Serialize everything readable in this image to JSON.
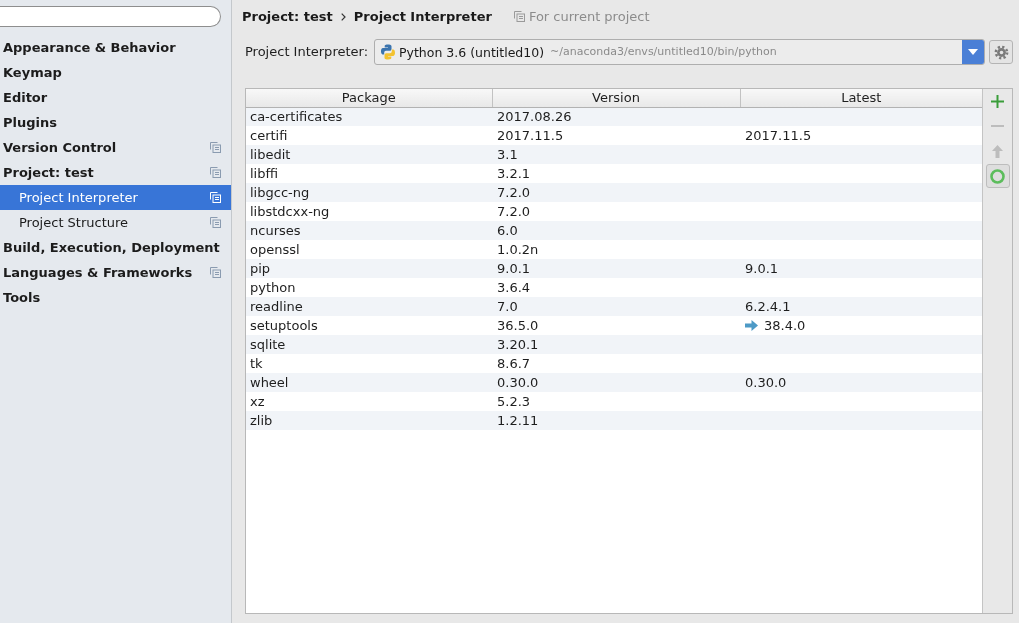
{
  "sidebar": {
    "items": [
      {
        "label": "Appearance & Behavior",
        "selected": false,
        "project_level": false
      },
      {
        "label": "Keymap",
        "selected": false,
        "project_level": false
      },
      {
        "label": "Editor",
        "selected": false,
        "project_level": false
      },
      {
        "label": "Plugins",
        "selected": false,
        "project_level": false
      },
      {
        "label": "Version Control",
        "selected": false,
        "project_level": true
      },
      {
        "label": "Project: test",
        "selected": false,
        "project_level": true,
        "children": [
          {
            "label": "Project Interpreter",
            "selected": true,
            "project_level": true
          },
          {
            "label": "Project Structure",
            "selected": false,
            "project_level": true
          }
        ]
      },
      {
        "label": "Build, Execution, Deployment",
        "selected": false,
        "project_level": false
      },
      {
        "label": "Languages & Frameworks",
        "selected": false,
        "project_level": true
      },
      {
        "label": "Tools",
        "selected": false,
        "project_level": false
      }
    ]
  },
  "breadcrumb": {
    "items": [
      "Project: test",
      "Project Interpreter"
    ],
    "scope": "For current project"
  },
  "interpreter": {
    "label": "Project Interpreter:",
    "name": "Python 3.6 (untitled10)",
    "path": "~/anaconda3/envs/untitled10/bin/python"
  },
  "packages": {
    "columns": [
      "Package",
      "Version",
      "Latest"
    ],
    "rows": [
      {
        "package": "ca-certificates",
        "version": "2017.08.26",
        "upgrade": false
      },
      {
        "package": "certifi",
        "version": "2017.11.5",
        "latest": "2017.11.5",
        "upgrade": false
      },
      {
        "package": "libedit",
        "version": "3.1",
        "upgrade": false
      },
      {
        "package": "libffi",
        "version": "3.2.1",
        "upgrade": false
      },
      {
        "package": "libgcc-ng",
        "version": "7.2.0",
        "upgrade": false
      },
      {
        "package": "libstdcxx-ng",
        "version": "7.2.0",
        "upgrade": false
      },
      {
        "package": "ncurses",
        "version": "6.0",
        "upgrade": false
      },
      {
        "package": "openssl",
        "version": "1.0.2n",
        "upgrade": false
      },
      {
        "package": "pip",
        "version": "9.0.1",
        "latest": "9.0.1",
        "upgrade": false
      },
      {
        "package": "python",
        "version": "3.6.4",
        "upgrade": false
      },
      {
        "package": "readline",
        "version": "7.0",
        "latest": "6.2.4.1",
        "upgrade": false
      },
      {
        "package": "setuptools",
        "version": "36.5.0",
        "latest": "38.4.0",
        "upgrade": true
      },
      {
        "package": "sqlite",
        "version": "3.20.1",
        "upgrade": false
      },
      {
        "package": "tk",
        "version": "8.6.7",
        "upgrade": false
      },
      {
        "package": "wheel",
        "version": "0.30.0",
        "latest": "0.30.0",
        "upgrade": false
      },
      {
        "package": "xz",
        "version": "5.2.3",
        "upgrade": false
      },
      {
        "package": "zlib",
        "version": "1.2.11",
        "upgrade": false
      }
    ]
  },
  "toolbar": [
    {
      "kind": "add",
      "disabled": false,
      "active": false
    },
    {
      "kind": "remove",
      "disabled": true,
      "active": false
    },
    {
      "kind": "upgrade",
      "disabled": true,
      "active": false
    },
    {
      "kind": "refresh",
      "disabled": false,
      "active": true
    }
  ]
}
